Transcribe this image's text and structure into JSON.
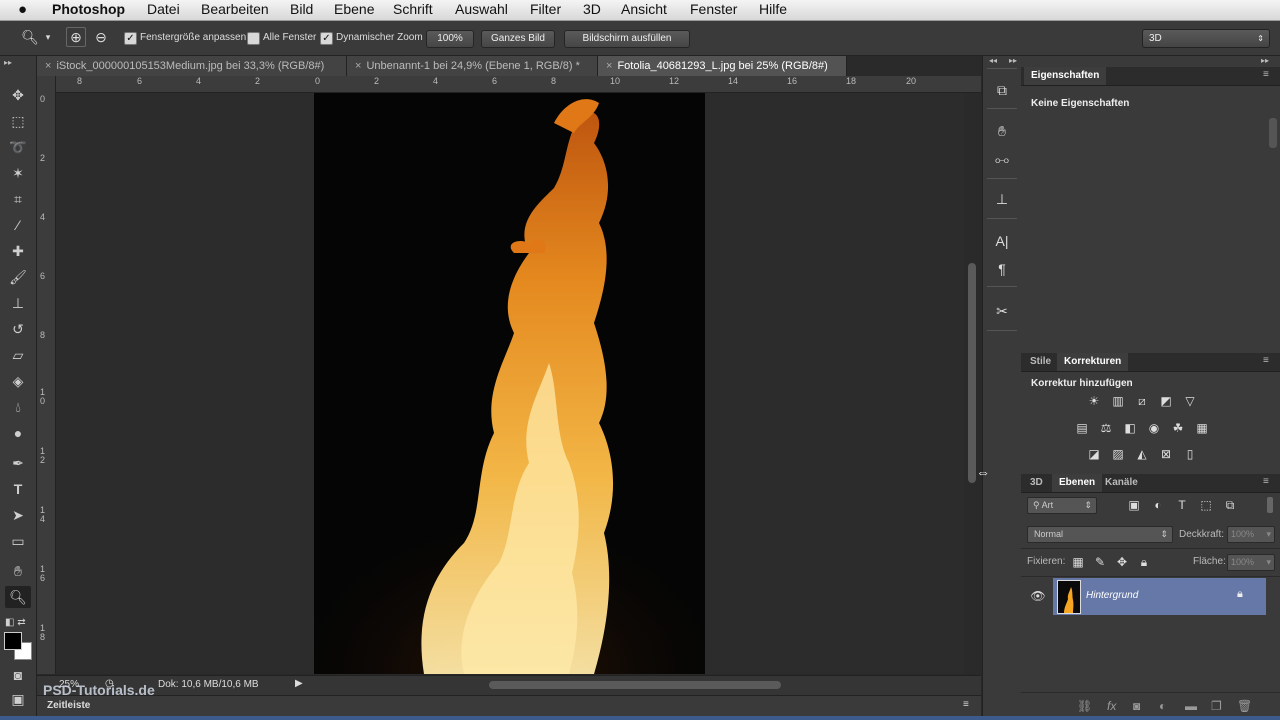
{
  "menubar": {
    "apple": "",
    "app_name": "Photoshop",
    "items": [
      "Datei",
      "Bearbeiten",
      "Bild",
      "Ebene",
      "Schrift",
      "Auswahl",
      "Filter",
      "3D",
      "Ansicht",
      "Fenster",
      "Hilfe"
    ]
  },
  "options": {
    "resize_windows_label": "Fenstergröße anpassen",
    "all_windows_label": "Alle Fenster",
    "scrubby_zoom_label": "Dynamischer Zoom",
    "btn_100": "100%",
    "btn_fit": "Ganzes Bild",
    "btn_fill": "Bildschirm ausfüllen",
    "workspace": "3D",
    "checked": {
      "resize_windows": true,
      "all_windows": false,
      "scrubby_zoom": true
    }
  },
  "tabs": [
    {
      "close": "×",
      "label": "iStock_000000105153Medium.jpg bei 33,3% (RGB/8#)"
    },
    {
      "close": "×",
      "label": "Unbenannt-1 bei 24,9% (Ebene 1, RGB/8) *"
    },
    {
      "close": "×",
      "label": "Fotolia_40681293_L.jpg bei 25% (RGB/8#)"
    }
  ],
  "ruler": {
    "h": [
      "8",
      "6",
      "4",
      "2",
      "0",
      "2",
      "4",
      "6",
      "8",
      "10",
      "12",
      "14",
      "16",
      "18",
      "20"
    ],
    "v": [
      "0",
      "2",
      "4",
      "6",
      "8",
      "1\n0",
      "1\n2",
      "1\n4",
      "1\n6",
      "1\n8"
    ]
  },
  "status": {
    "zoom": "25%",
    "doc": "Dok: 10,6 MB/10,6 MB",
    "timeline": "Zeitleiste",
    "watermark": "PSD-Tutorials.de"
  },
  "properties": {
    "tab": "Eigenschaften",
    "content": "Keine Eigenschaften"
  },
  "adjustments": {
    "tabs": [
      "Stile",
      "Korrekturen"
    ],
    "title": "Korrektur hinzufügen"
  },
  "layers": {
    "tabs": [
      "3D",
      "Ebenen",
      "Kanäle"
    ],
    "filter_kind": "Art",
    "blend_mode": "Normal",
    "opacity_label": "Deckkraft:",
    "opacity_value": "100%",
    "lock_label": "Fixieren:",
    "fill_label": "Fläche:",
    "fill_value": "100%",
    "layer_name": "Hintergrund"
  },
  "colors": {
    "accent_layer": "#6678a8",
    "flame": "#f5a623"
  }
}
